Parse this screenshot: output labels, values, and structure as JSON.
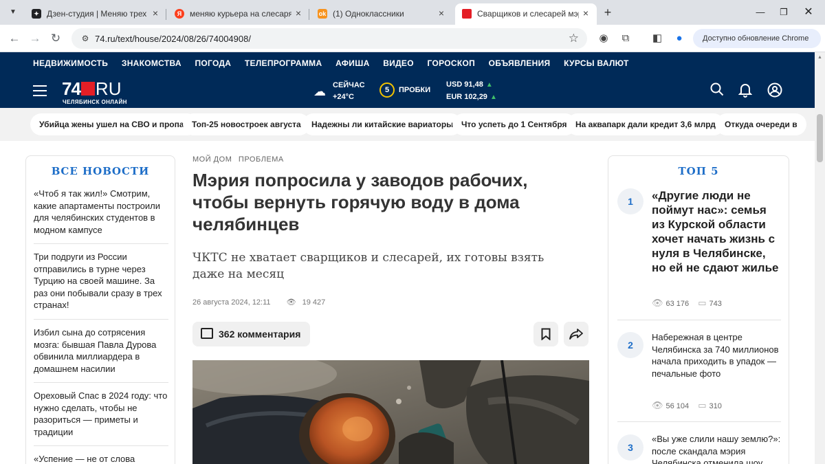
{
  "browser": {
    "tabs": [
      {
        "title": "Дзен-студия | Меняю трех кур",
        "favicon": "dzen-icon",
        "color": "#202124"
      },
      {
        "title": "меняю курьера на слесаря —",
        "favicon": "yandex-icon",
        "color": "#fc3f1d"
      },
      {
        "title": "(1) Одноклассники",
        "favicon": "ok-icon",
        "color": "#f7931e"
      },
      {
        "title": "Сварщиков и слесарей мэрия",
        "favicon": "74ru-icon",
        "color": "#e41e26"
      }
    ],
    "url": "74.ru/text/house/2024/08/26/74004908/",
    "update_label": "Доступно обновление Chrome"
  },
  "site": {
    "nav": [
      "НЕДВИЖИМОСТЬ",
      "ЗНАКОМСТВА",
      "ПОГОДА",
      "ТЕЛЕПРОГРАММА",
      "АФИША",
      "ВИДЕО",
      "ГОРОСКОП",
      "ОБЪЯВЛЕНИЯ",
      "КУРСЫ ВАЛЮТ"
    ],
    "logo_num": "74",
    "logo_ru": "RU",
    "logo_sub": "ЧЕЛЯБИНСК ОНЛАЙН",
    "weather_label": "СЕЙЧАС",
    "weather_temp": "+24°C",
    "traffic_level": "5",
    "traffic_label": "ПРОБКИ",
    "usd": "USD 91,48",
    "eur": "EUR 102,29",
    "accent": "#002a58",
    "brand_red": "#e41e26"
  },
  "trending": [
    "Убийца жены ушел на СВО и пропал",
    "Топ-25 новостроек августа",
    "Надежны ли китайские вариаторы",
    "Что успеть до 1 Сентября",
    "На аквапарк дали кредит 3,6 млрд",
    "Откуда очереди в"
  ],
  "left": {
    "title": "ВСЕ НОВОСТИ",
    "items": [
      "«Чтоб я так жил!» Смотрим, какие апартаменты построили для челябинских студентов в модном кампусе",
      "Три подруги из России отправились в турне через Турцию на своей машине. За раз они побывали сразу в трех странах!",
      "Избил сына до сотрясения мозга: бывшая Павла Дурова обвинила миллиардера в домашнем насилии",
      "Ореховый Спас в 2024 году: что нужно сделать, чтобы не разориться — приметы и традиции",
      "«Успение — не от слова"
    ]
  },
  "article": {
    "rubrics": [
      "МОЙ ДОМ",
      "ПРОБЛЕМА"
    ],
    "title": "Мэрия попросила у заводов рабочих, чтобы вернуть горячую воду в дома челябинцев",
    "lead": "ЧКТС не хватает сварщиков и слесарей, их готовы взять даже на месяц",
    "date": "26 августа 2024, 12:11",
    "views": "19 427",
    "comments": "362",
    "comments_word": "комментария"
  },
  "top": {
    "title": "ТОП 5",
    "items": [
      {
        "num": "1",
        "title": "«Другие люди не поймут нас»: семья из Курской области хочет начать жизнь с нуля в Челябинске, но ей не сдают жилье",
        "views": "63 176",
        "comments": "743"
      },
      {
        "num": "2",
        "title": "Набережная в центре Челябинска за 740 миллионов начала приходить в упадок — печальные фото",
        "views": "56 104",
        "comments": "310"
      },
      {
        "num": "3",
        "title": "«Вы уже слили нашу землю?»: после скандала мэрия Челябинска отменила шоу"
      }
    ]
  }
}
